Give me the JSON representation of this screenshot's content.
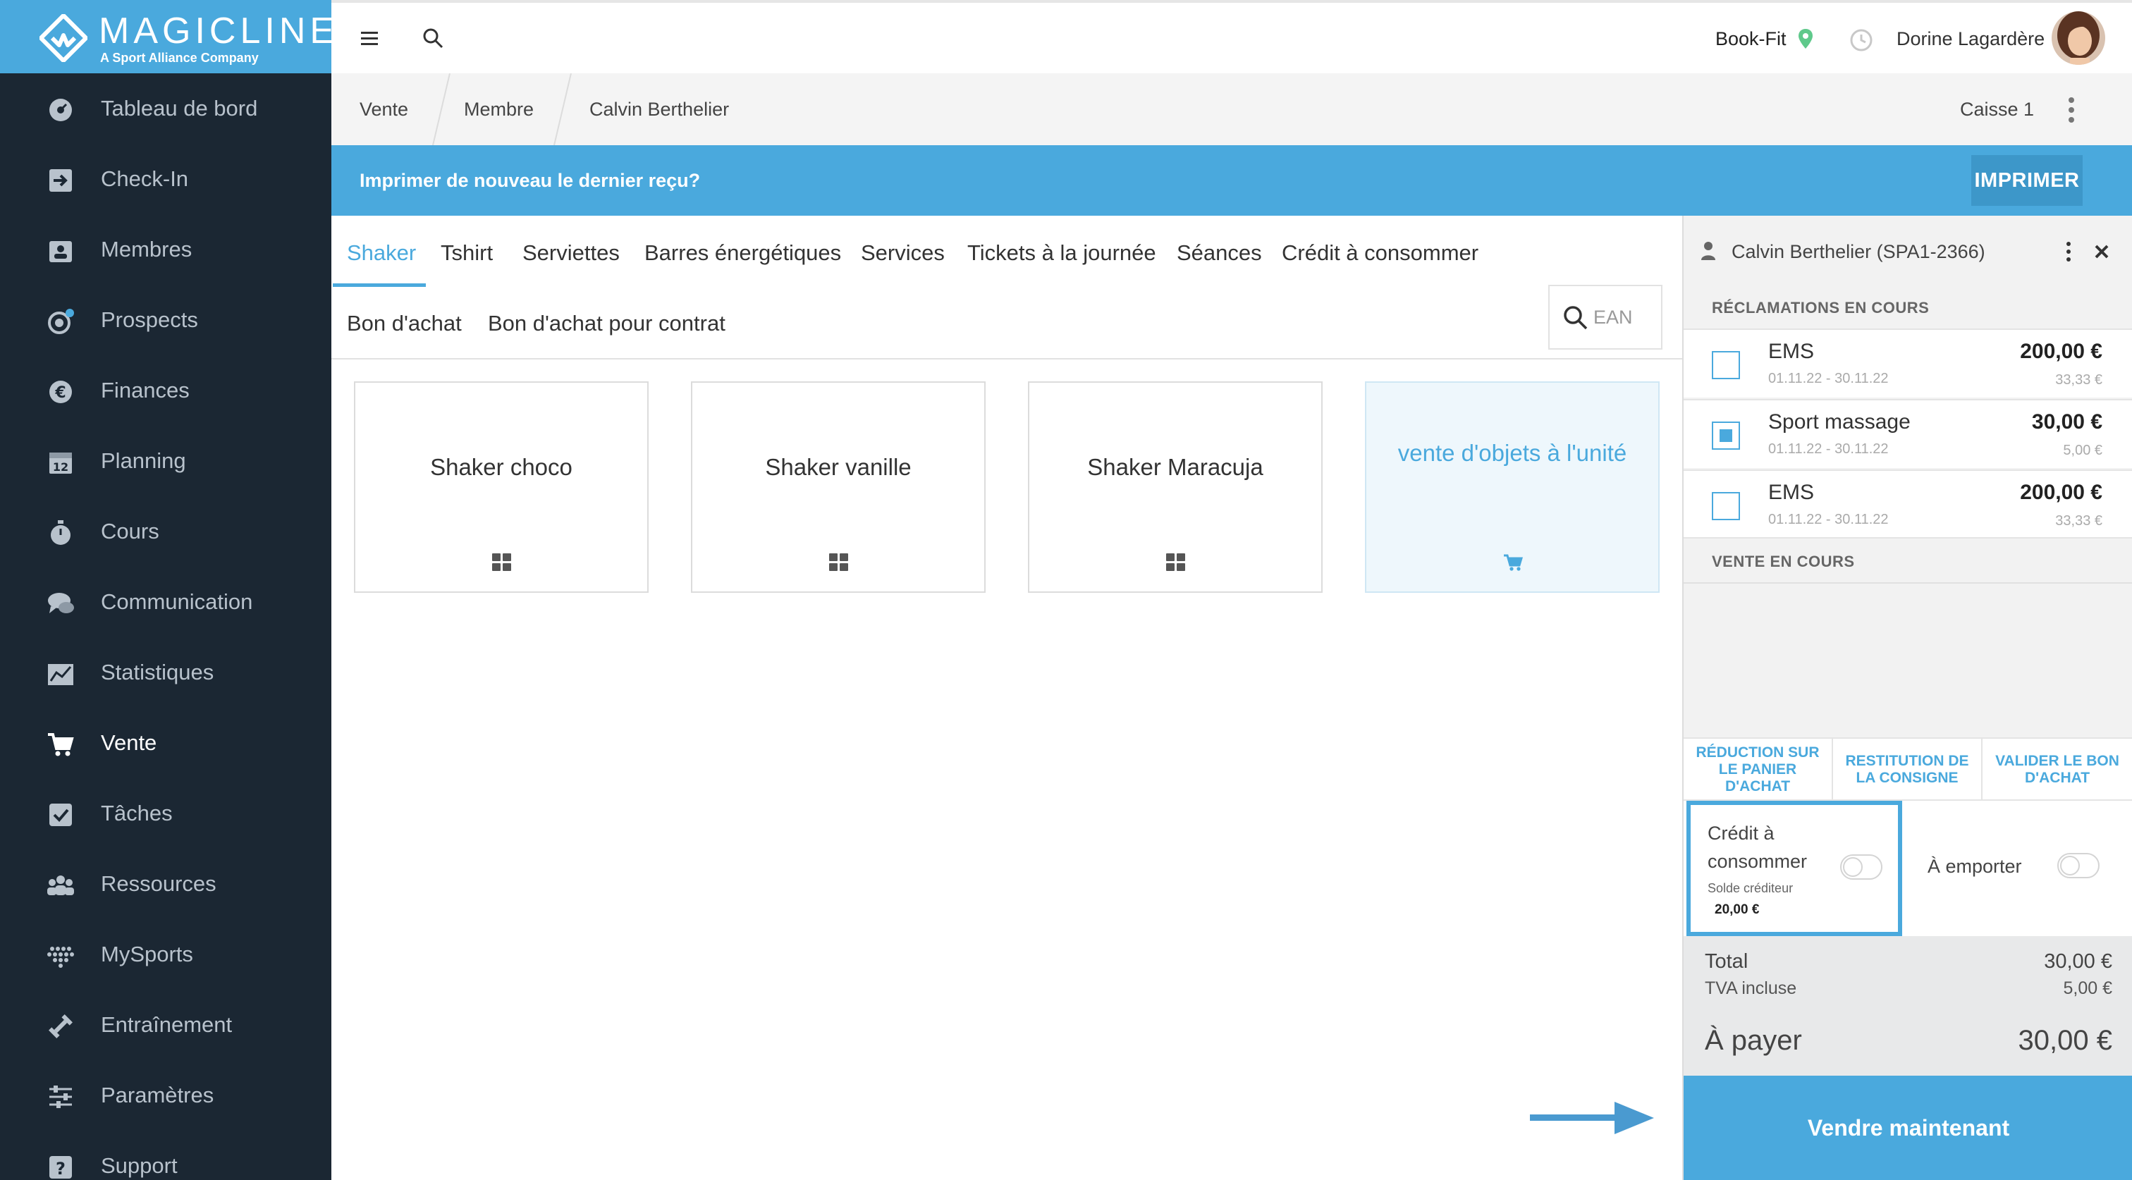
{
  "logo": {
    "name": "MAGICLINE",
    "tagline": "A Sport Alliance Company"
  },
  "sidebar": {
    "items": [
      {
        "label": "Tableau de bord",
        "icon": "dashboard-icon"
      },
      {
        "label": "Check-In",
        "icon": "check-in-icon"
      },
      {
        "label": "Membres",
        "icon": "members-icon"
      },
      {
        "label": "Prospects",
        "icon": "prospects-icon"
      },
      {
        "label": "Finances",
        "icon": "euro-icon"
      },
      {
        "label": "Planning",
        "icon": "calendar-icon"
      },
      {
        "label": "Cours",
        "icon": "stopwatch-icon"
      },
      {
        "label": "Communication",
        "icon": "chat-icon"
      },
      {
        "label": "Statistiques",
        "icon": "chart-icon"
      },
      {
        "label": "Vente",
        "icon": "cart-icon"
      },
      {
        "label": "Tâches",
        "icon": "checkbox-icon"
      },
      {
        "label": "Ressources",
        "icon": "people-icon"
      },
      {
        "label": "MySports",
        "icon": "dots-grid-icon"
      },
      {
        "label": "Entraînement",
        "icon": "dumbbell-icon"
      },
      {
        "label": "Paramètres",
        "icon": "sliders-icon"
      },
      {
        "label": "Support",
        "icon": "question-icon"
      }
    ],
    "active": "Vente"
  },
  "topbar": {
    "studio": "Book-Fit",
    "user": "Dorine Lagardère"
  },
  "breadcrumb": {
    "items": [
      "Vente",
      "Membre",
      "Calvin Berthelier"
    ],
    "register": "Caisse 1"
  },
  "banner": {
    "text": "Imprimer de nouveau le dernier reçu?",
    "button": "IMPRIMER"
  },
  "catalog": {
    "tabs": [
      "Shaker",
      "Tshirt",
      "Serviettes",
      "Barres énergétiques",
      "Services",
      "Tickets à la journée",
      "Séances",
      "Crédit à consommer",
      "Bon d'achat",
      "Bon d'achat pour contrat"
    ],
    "active_tab": "Shaker",
    "ean_placeholder": "EAN",
    "products": [
      {
        "name": "Shaker choco",
        "icon": "grid-icon"
      },
      {
        "name": "Shaker vanille",
        "icon": "grid-icon"
      },
      {
        "name": "Shaker Maracuja",
        "icon": "grid-icon"
      },
      {
        "name": "vente d'objets à l'unité",
        "icon": "cart-icon"
      }
    ]
  },
  "cart": {
    "customer": "Calvin Berthelier (SPA1-2366)",
    "claims_title": "RÉCLAMATIONS EN COURS",
    "claims": [
      {
        "name": "EMS",
        "dates": "01.11.22 - 30.11.22",
        "price": "200,00 €",
        "sub": "33,33 €",
        "checked": false
      },
      {
        "name": "Sport massage",
        "dates": "01.11.22 - 30.11.22",
        "price": "30,00 €",
        "sub": "5,00 €",
        "checked": true
      },
      {
        "name": "EMS",
        "dates": "01.11.22 - 30.11.22",
        "price": "200,00 €",
        "sub": "33,33 €",
        "checked": false
      }
    ],
    "current_sale_title": "VENTE EN COURS",
    "actions": [
      "RÉDUCTION SUR LE PANIER D'ACHAT",
      "RESTITUTION DE LA CONSIGNE",
      "VALIDER LE BON D'ACHAT"
    ],
    "credit": {
      "label": "Crédit à consommer",
      "balance_label": "Solde créditeur",
      "balance": "20,00 €"
    },
    "takeaway": "À emporter",
    "totals": {
      "total_label": "Total",
      "total": "30,00 €",
      "tva_label": "TVA incluse",
      "tva": "5,00 €",
      "pay_label": "À payer",
      "pay": "30,00 €"
    },
    "sell_button": "Vendre maintenant"
  },
  "colors": {
    "accent": "#4aa9dd",
    "sidebar": "#1b2733"
  }
}
